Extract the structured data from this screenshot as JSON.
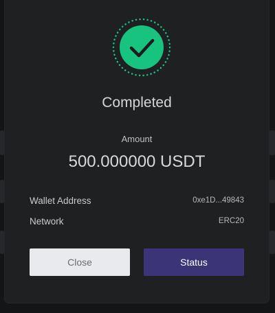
{
  "modal": {
    "status_icon": "check-icon",
    "title": "Completed",
    "amount_label": "Amount",
    "amount_value": "500.000000 USDT",
    "details": [
      {
        "label": "Wallet Address",
        "value": "0xe1D...49843"
      },
      {
        "label": "Network",
        "value": "ERC20"
      }
    ],
    "close_label": "Close",
    "status_label": "Status"
  },
  "colors": {
    "accent_green": "#18c27f",
    "status_button": "#3b3577",
    "close_button": "#e9eaed",
    "modal_bg": "#1f2022"
  }
}
